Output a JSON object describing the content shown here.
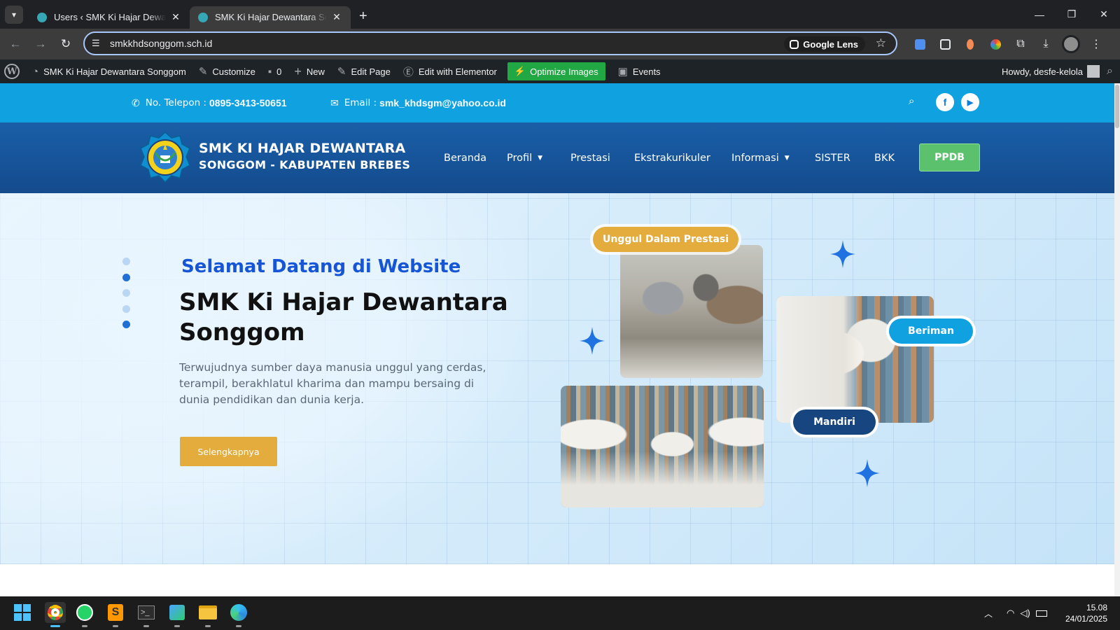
{
  "browser": {
    "tabs": [
      {
        "title": "Users ‹ SMK Ki Hajar Dewantara",
        "active": false
      },
      {
        "title": "SMK Ki Hajar Dewantara Songgom",
        "active": true
      }
    ],
    "new_tab": "+",
    "url": "smkkhdsonggom.sch.id",
    "google_lens_label": "Google Lens",
    "window_controls": {
      "minimize": "—",
      "restore": "❐",
      "close": "✕"
    }
  },
  "admin_bar": {
    "site_name": "SMK Ki Hajar Dewantara Songgom",
    "customize": "Customize",
    "comments_count": "0",
    "new": "New",
    "edit_page": "Edit Page",
    "edit_elementor": "Edit with Elementor",
    "optimize_images": "Optimize Images",
    "events": "Events",
    "howdy": "Howdy, desfe-kelola"
  },
  "topbar": {
    "phone_label": "No. Telepon :",
    "phone_value": "0895-3413-50651",
    "email_label": "Email :",
    "email_value": "smk_khdsgm@yahoo.co.id",
    "social": [
      "facebook-icon",
      "youtube-icon"
    ]
  },
  "header": {
    "brand_line1": "SMK KI HAJAR DEWANTARA",
    "brand_line2": "SONGGOM - KABUPATEN BREBES",
    "nav": [
      {
        "label": "Beranda",
        "dropdown": false
      },
      {
        "label": "Profil",
        "dropdown": true
      },
      {
        "label": "Prestasi",
        "dropdown": false
      },
      {
        "label": "Ekstrakurikuler",
        "dropdown": false
      },
      {
        "label": "Informasi",
        "dropdown": true
      },
      {
        "label": "SISTER",
        "dropdown": false
      },
      {
        "label": "BKK",
        "dropdown": false
      }
    ],
    "cta": "PPDB"
  },
  "hero": {
    "welcome": "Selamat Datang di Website",
    "title": "SMK Ki Hajar Dewantara Songgom",
    "description": "Terwujudnya sumber daya manusia unggul yang cerdas, terampil, berakhlatul kharima dan mampu bersaing di dunia pendidikan dan dunia kerja.",
    "button": "Selengkapnya",
    "badges": {
      "gold": "Unggul Dalam Prestasi",
      "blue": "Beriman",
      "navy": "Mandiri"
    }
  },
  "taskbar": {
    "time": "15.08",
    "date": "24/01/2025"
  },
  "colors": {
    "topbar": "#0fa1e0",
    "header": "#1a5fa8",
    "accent_gold": "#e3ac3c",
    "ppdb_green": "#5cc16c",
    "welcome_blue": "#1555d6",
    "navy": "#17457f"
  }
}
